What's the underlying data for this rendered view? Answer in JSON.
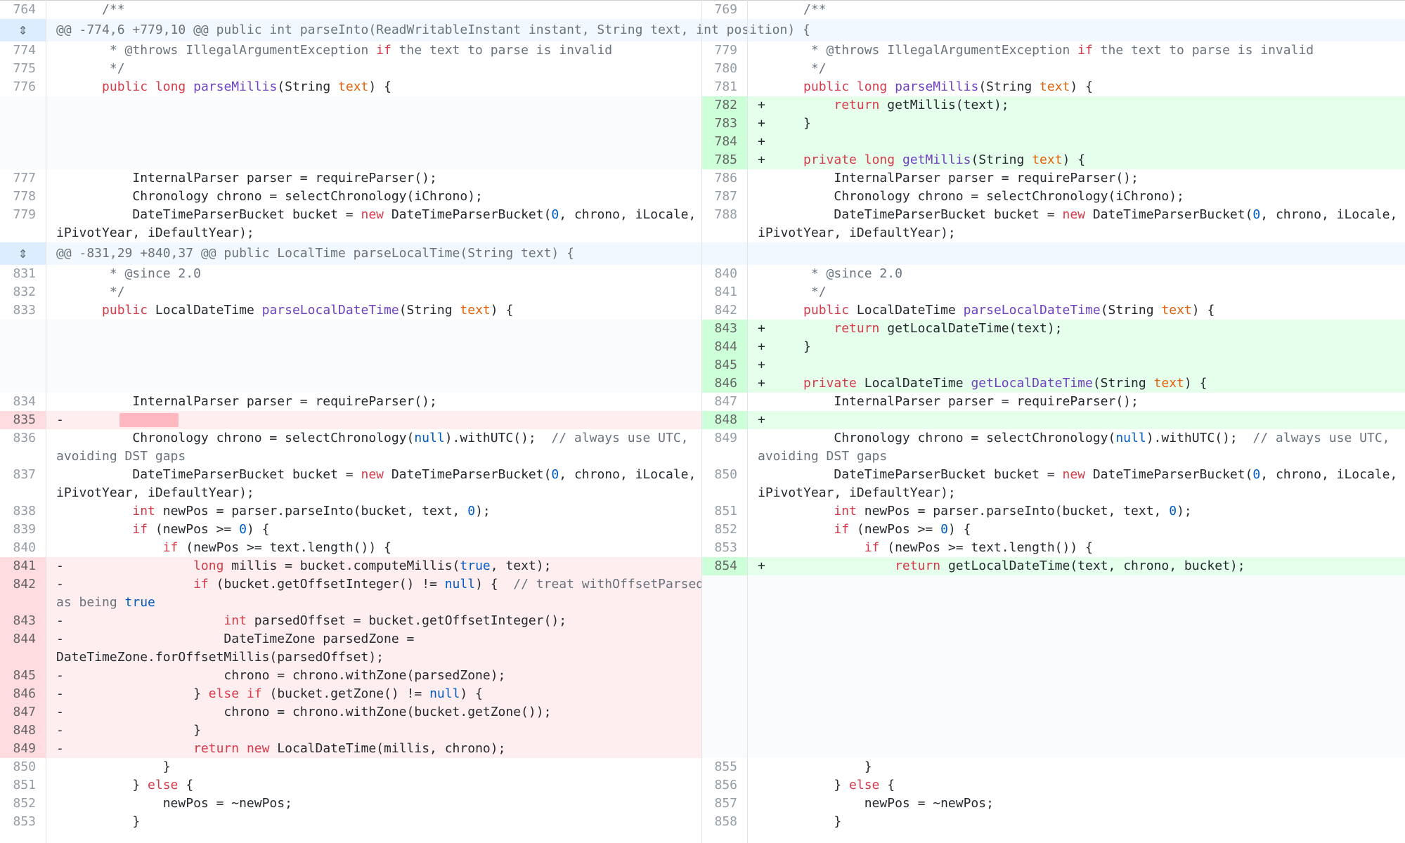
{
  "hunks": [
    {
      "header": "@@ -774,6 +779,10 @@ public int parseInto(ReadWritableInstant instant, String text, int position) {"
    },
    {
      "header": "@@ -831,29 +840,37 @@ public LocalTime parseLocalTime(String text) {"
    }
  ],
  "rows": [
    {
      "type": "ctx",
      "left": {
        "n": "764",
        "html": "      /**"
      },
      "right": {
        "n": "769",
        "html": "      /**"
      }
    },
    {
      "type": "hunk",
      "hunk": 0
    },
    {
      "type": "ctx",
      "left": {
        "n": "774",
        "html": "       * @throws IllegalArgumentException if the text to parse is invalid"
      },
      "right": {
        "n": "779",
        "html": "       * @throws IllegalArgumentException if the text to parse is invalid"
      }
    },
    {
      "type": "ctx",
      "left": {
        "n": "775",
        "html": "       */"
      },
      "right": {
        "n": "780",
        "html": "       */"
      }
    },
    {
      "type": "ctx",
      "left": {
        "n": "776",
        "html": "      public long parseMillis(String text) {"
      },
      "right": {
        "n": "781",
        "html": "      public long parseMillis(String text) {"
      }
    },
    {
      "type": "addonly",
      "right": {
        "n": "782",
        "html": "+         return getMillis(text);"
      }
    },
    {
      "type": "addonly",
      "right": {
        "n": "783",
        "html": "+     }"
      }
    },
    {
      "type": "addonly",
      "right": {
        "n": "784",
        "html": "+"
      }
    },
    {
      "type": "addonly",
      "right": {
        "n": "785",
        "html": "+     private long getMillis(String text) {"
      }
    },
    {
      "type": "ctx",
      "left": {
        "n": "777",
        "html": "          InternalParser parser = requireParser();"
      },
      "right": {
        "n": "786",
        "html": "          InternalParser parser = requireParser();"
      }
    },
    {
      "type": "ctx",
      "left": {
        "n": "778",
        "html": "          Chronology chrono = selectChronology(iChrono);"
      },
      "right": {
        "n": "787",
        "html": "          Chronology chrono = selectChronology(iChrono);"
      }
    },
    {
      "type": "ctx",
      "left": {
        "n": "779",
        "html": "          DateTimeParserBucket bucket = new DateTimeParserBucket(0, chrono, iLocale,"
      },
      "right": {
        "n": "788",
        "html": "          DateTimeParserBucket bucket = new DateTimeParserBucket(0, chrono, iLocale,"
      }
    },
    {
      "type": "ctx",
      "left": {
        "n": "",
        "html": "iPivotYear, iDefaultYear);"
      },
      "right": {
        "n": "",
        "html": "iPivotYear, iDefaultYear);"
      }
    },
    {
      "type": "hunk",
      "hunk": 1
    },
    {
      "type": "ctx",
      "left": {
        "n": "831",
        "html": "       * @since 2.0"
      },
      "right": {
        "n": "840",
        "html": "       * @since 2.0"
      }
    },
    {
      "type": "ctx",
      "left": {
        "n": "832",
        "html": "       */"
      },
      "right": {
        "n": "841",
        "html": "       */"
      }
    },
    {
      "type": "ctx",
      "left": {
        "n": "833",
        "html": "      public LocalDateTime parseLocalDateTime(String text) {"
      },
      "right": {
        "n": "842",
        "html": "      public LocalDateTime parseLocalDateTime(String text) {"
      }
    },
    {
      "type": "addonly",
      "right": {
        "n": "843",
        "html": "+         return getLocalDateTime(text);"
      }
    },
    {
      "type": "addonly",
      "right": {
        "n": "844",
        "html": "+     }"
      }
    },
    {
      "type": "addonly",
      "right": {
        "n": "845",
        "html": "+"
      }
    },
    {
      "type": "addonly",
      "right": {
        "n": "846",
        "html": "+     private LocalDateTime getLocalDateTime(String text) {"
      }
    },
    {
      "type": "ctx",
      "left": {
        "n": "834",
        "html": "          InternalParser parser = requireParser();"
      },
      "right": {
        "n": "847",
        "html": "          InternalParser parser = requireParser();"
      }
    },
    {
      "type": "change",
      "left": {
        "n": "835",
        "html": "-"
      },
      "right": {
        "n": "848",
        "html": "+"
      }
    },
    {
      "type": "ctx",
      "left": {
        "n": "836",
        "html": "          Chronology chrono = selectChronology(null).withUTC();  // always use UTC,"
      },
      "right": {
        "n": "849",
        "html": "          Chronology chrono = selectChronology(null).withUTC();  // always use UTC,"
      }
    },
    {
      "type": "ctx",
      "left": {
        "n": "",
        "html": "avoiding DST gaps"
      },
      "right": {
        "n": "",
        "html": "avoiding DST gaps"
      }
    },
    {
      "type": "ctx",
      "left": {
        "n": "837",
        "html": "          DateTimeParserBucket bucket = new DateTimeParserBucket(0, chrono, iLocale,"
      },
      "right": {
        "n": "850",
        "html": "          DateTimeParserBucket bucket = new DateTimeParserBucket(0, chrono, iLocale,"
      }
    },
    {
      "type": "ctx",
      "left": {
        "n": "",
        "html": "iPivotYear, iDefaultYear);"
      },
      "right": {
        "n": "",
        "html": "iPivotYear, iDefaultYear);"
      }
    },
    {
      "type": "ctx",
      "left": {
        "n": "838",
        "html": "          int newPos = parser.parseInto(bucket, text, 0);"
      },
      "right": {
        "n": "851",
        "html": "          int newPos = parser.parseInto(bucket, text, 0);"
      }
    },
    {
      "type": "ctx",
      "left": {
        "n": "839",
        "html": "          if (newPos >= 0) {"
      },
      "right": {
        "n": "852",
        "html": "          if (newPos >= 0) {"
      }
    },
    {
      "type": "ctx",
      "left": {
        "n": "840",
        "html": "              if (newPos >= text.length()) {"
      },
      "right": {
        "n": "853",
        "html": "              if (newPos >= text.length()) {"
      }
    },
    {
      "type": "change",
      "left": {
        "n": "841",
        "html": "-                 long millis = bucket.computeMillis(true, text);"
      },
      "right": {
        "n": "854",
        "html": "+                 return getLocalDateTime(text, chrono, bucket);"
      }
    },
    {
      "type": "delonly",
      "left": {
        "n": "842",
        "html": "-                 if (bucket.getOffsetInteger() != null) {  // treat withOffsetParsed()"
      }
    },
    {
      "type": "delonly",
      "left": {
        "n": "",
        "html": "as being true"
      }
    },
    {
      "type": "delonly",
      "left": {
        "n": "843",
        "html": "-                     int parsedOffset = bucket.getOffsetInteger();"
      }
    },
    {
      "type": "delonly",
      "left": {
        "n": "844",
        "html": "-                     DateTimeZone parsedZone ="
      }
    },
    {
      "type": "delonly",
      "left": {
        "n": "",
        "html": "DateTimeZone.forOffsetMillis(parsedOffset);"
      }
    },
    {
      "type": "delonly",
      "left": {
        "n": "845",
        "html": "-                     chrono = chrono.withZone(parsedZone);"
      }
    },
    {
      "type": "delonly",
      "left": {
        "n": "846",
        "html": "-                 } else if (bucket.getZone() != null) {"
      }
    },
    {
      "type": "delonly",
      "left": {
        "n": "847",
        "html": "-                     chrono = chrono.withZone(bucket.getZone());"
      }
    },
    {
      "type": "delonly",
      "left": {
        "n": "848",
        "html": "-                 }"
      }
    },
    {
      "type": "delonly",
      "left": {
        "n": "849",
        "html": "-                 return new LocalDateTime(millis, chrono);"
      }
    },
    {
      "type": "ctx",
      "left": {
        "n": "850",
        "html": "              }"
      },
      "right": {
        "n": "855",
        "html": "              }"
      }
    },
    {
      "type": "ctx",
      "left": {
        "n": "851",
        "html": "          } else {"
      },
      "right": {
        "n": "856",
        "html": "          } else {"
      }
    },
    {
      "type": "ctx",
      "left": {
        "n": "852",
        "html": "              newPos = ~newPos;"
      },
      "right": {
        "n": "857",
        "html": "              newPos = ~newPos;"
      }
    },
    {
      "type": "ctx",
      "left": {
        "n": "853",
        "html": "          }"
      },
      "right": {
        "n": "858",
        "html": "          }"
      }
    }
  ]
}
